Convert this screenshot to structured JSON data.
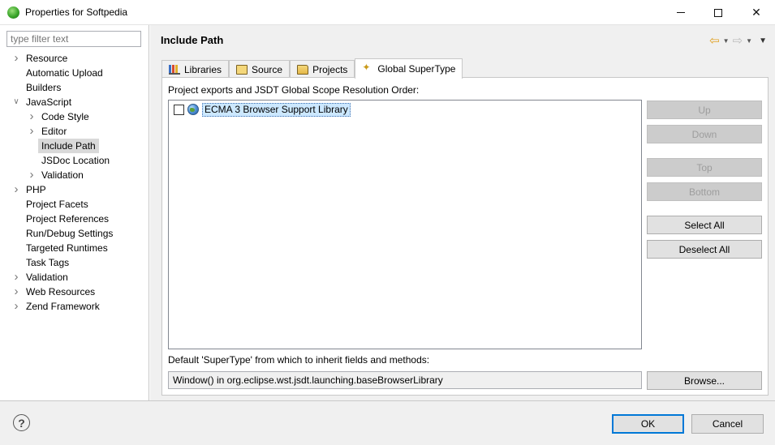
{
  "window": {
    "title": "Properties for Softpedia",
    "app_icon": "eclipse-icon"
  },
  "filter": {
    "placeholder": "type filter text"
  },
  "tree": [
    {
      "label": "Resource",
      "level": 0,
      "expandable": true,
      "expanded": false
    },
    {
      "label": "Automatic Upload",
      "level": 0,
      "expandable": false
    },
    {
      "label": "Builders",
      "level": 0,
      "expandable": false
    },
    {
      "label": "JavaScript",
      "level": 0,
      "expandable": true,
      "expanded": true
    },
    {
      "label": "Code Style",
      "level": 1,
      "expandable": true,
      "expanded": false
    },
    {
      "label": "Editor",
      "level": 1,
      "expandable": true,
      "expanded": false
    },
    {
      "label": "Include Path",
      "level": 1,
      "expandable": false,
      "selected": true
    },
    {
      "label": "JSDoc Location",
      "level": 1,
      "expandable": false
    },
    {
      "label": "Validation",
      "level": 1,
      "expandable": true,
      "expanded": false
    },
    {
      "label": "PHP",
      "level": 0,
      "expandable": true,
      "expanded": false
    },
    {
      "label": "Project Facets",
      "level": 0,
      "expandable": false
    },
    {
      "label": "Project References",
      "level": 0,
      "expandable": false
    },
    {
      "label": "Run/Debug Settings",
      "level": 0,
      "expandable": false
    },
    {
      "label": "Targeted Runtimes",
      "level": 0,
      "expandable": false
    },
    {
      "label": "Task Tags",
      "level": 0,
      "expandable": false
    },
    {
      "label": "Validation",
      "level": 0,
      "expandable": true,
      "expanded": false
    },
    {
      "label": "Web Resources",
      "level": 0,
      "expandable": true,
      "expanded": false
    },
    {
      "label": "Zend Framework",
      "level": 0,
      "expandable": true,
      "expanded": false
    }
  ],
  "page": {
    "title": "Include Path"
  },
  "tabs": [
    {
      "label": "Libraries",
      "icon": "libraries-icon",
      "active": false
    },
    {
      "label": "Source",
      "icon": "source-folder-icon",
      "active": false
    },
    {
      "label": "Projects",
      "icon": "projects-folder-icon",
      "active": false
    },
    {
      "label": "Global SuperType",
      "icon": "global-supertype-icon",
      "active": true
    }
  ],
  "global_supertype": {
    "order_label": "Project exports and JSDT Global Scope Resolution Order:",
    "libraries": [
      {
        "label": "ECMA 3 Browser Support Library",
        "checked": false,
        "icon": "globe-icon"
      }
    ],
    "buttons": {
      "up": "Up",
      "down": "Down",
      "top": "Top",
      "bottom": "Bottom",
      "select_all": "Select All",
      "deselect_all": "Deselect All",
      "browse": "Browse..."
    },
    "supertype_label": "Default 'SuperType' from which to inherit fields and methods:",
    "supertype_value": "Window() in org.eclipse.wst.jsdt.launching.baseBrowserLibrary"
  },
  "footer": {
    "ok": "OK",
    "cancel": "Cancel",
    "help_icon": "help-icon"
  }
}
